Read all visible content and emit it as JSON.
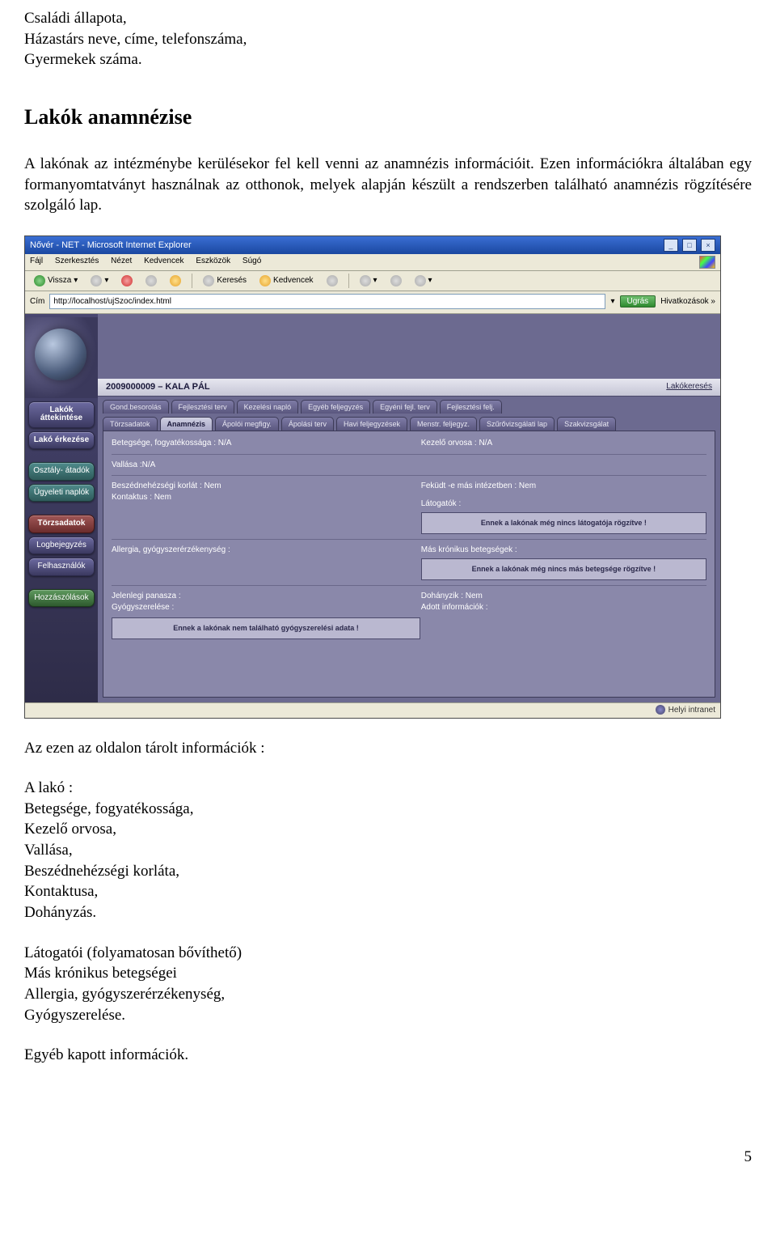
{
  "intro_lines": {
    "l1": "Családi állapota,",
    "l2": "Házastárs neve, címe, telefonszáma,",
    "l3": "Gyermekek száma."
  },
  "heading": "Lakók anamnézise",
  "para1": "A lakónak az intézménybe kerülésekor fel kell venni az anamnézis információit. Ezen információkra általában egy formanyomtatványt használnak az otthonok, melyek alapján készült a rendszerben található anamnézis rögzítésére szolgáló lap.",
  "screenshot": {
    "title": "Nővér - NET - Microsoft Internet Explorer",
    "win_min": "_",
    "win_max": "□",
    "win_close": "×",
    "menus": [
      "Fájl",
      "Szerkesztés",
      "Nézet",
      "Kedvencek",
      "Eszközök",
      "Súgó"
    ],
    "tb_back": "Vissza",
    "tb_search": "Keresés",
    "tb_fav": "Kedvencek",
    "addr_label": "Cím",
    "addr_value": "http://localhost/ujSzoc/index.html",
    "go": "Ugrás",
    "links": "Hivatkozások",
    "sidebar": [
      {
        "label": "Lakók\náttekintése",
        "cls": "nav-purple nav-bold"
      },
      {
        "label": "Lakó\nérkezése",
        "cls": "nav-purple nav-bold"
      },
      {
        "label": "Osztály-\nátadók",
        "cls": "nav-teal"
      },
      {
        "label": "Ügyeleti\nnaplók",
        "cls": "nav-teal"
      },
      {
        "label": "Törzsadatok",
        "cls": "nav-red"
      },
      {
        "label": "Logbejegyzés",
        "cls": "nav-purple"
      },
      {
        "label": "Felhasználók",
        "cls": "nav-purple"
      },
      {
        "label": "Hozzászólások",
        "cls": "nav-green"
      }
    ],
    "patient": "2009000009 – KALA PÁL",
    "patient_search": "Lakókeresés",
    "tabs1": [
      "Gond.besorolás",
      "Fejlesztési terv",
      "Kezelési napló",
      "Egyéb feljegyzés",
      "Egyéni fejl. terv",
      "Fejlesztési felj."
    ],
    "tabs2": [
      "Törzsadatok",
      "Anamnézis",
      "Ápolói megfigy.",
      "Ápolási terv",
      "Havi feljegyzések",
      "Menstr. feljegyz.",
      "Szűrővizsgálati lap",
      "Szakvizsgálat"
    ],
    "tabs2_active_index": 1,
    "fields": {
      "betegsege": "Betegsége, fogyatékossága : N/A",
      "kezelo": "Kezelő orvosa : N/A",
      "vallasa": "Vallása :N/A",
      "beszed": "Beszédnehézségi korlát : Nem",
      "fekudt": "Feküdt -e más intézetben : Nem",
      "kontaktus": "Kontaktus : Nem",
      "latogatok": "Látogatók :",
      "latogatok_box": "Ennek a lakónak még nincs\nlátogatója rögzítve !",
      "allergia": "Allergia, gyógyszerérzékenység :",
      "kronikus": "Más krónikus betegségek :",
      "kronikus_box": "Ennek a lakónak még nincs\nmás betegsége rögzítve !",
      "jelenlegi": "Jelenlegi panasza :",
      "dohanyzik": "Dohányzik : Nem",
      "gyogyszerelese": "Gyógyszerelése :",
      "adott": "Adott információk :",
      "gyogy_box": "Ennek a lakónak nem található gyógyszerelési adata !"
    },
    "status": "Helyi intranet"
  },
  "stored_heading": "Az ezen az oldalon tárolt információk :",
  "list1": {
    "head": "A lakó :",
    "i1": "Betegsége, fogyatékossága,",
    "i2": "Kezelő orvosa,",
    "i3": "Vallása,",
    "i4": "Beszédnehézségi korláta,",
    "i5": "Kontaktusa,",
    "i6": "Dohányzás."
  },
  "list2": {
    "i1": "Látogatói (folyamatosan bővíthető)",
    "i2": "Más krónikus betegségei",
    "i3": "Allergia, gyógyszerérzékenység,",
    "i4": "Gyógyszerelése."
  },
  "list3": "Egyéb kapott információk.",
  "page_number": "5"
}
